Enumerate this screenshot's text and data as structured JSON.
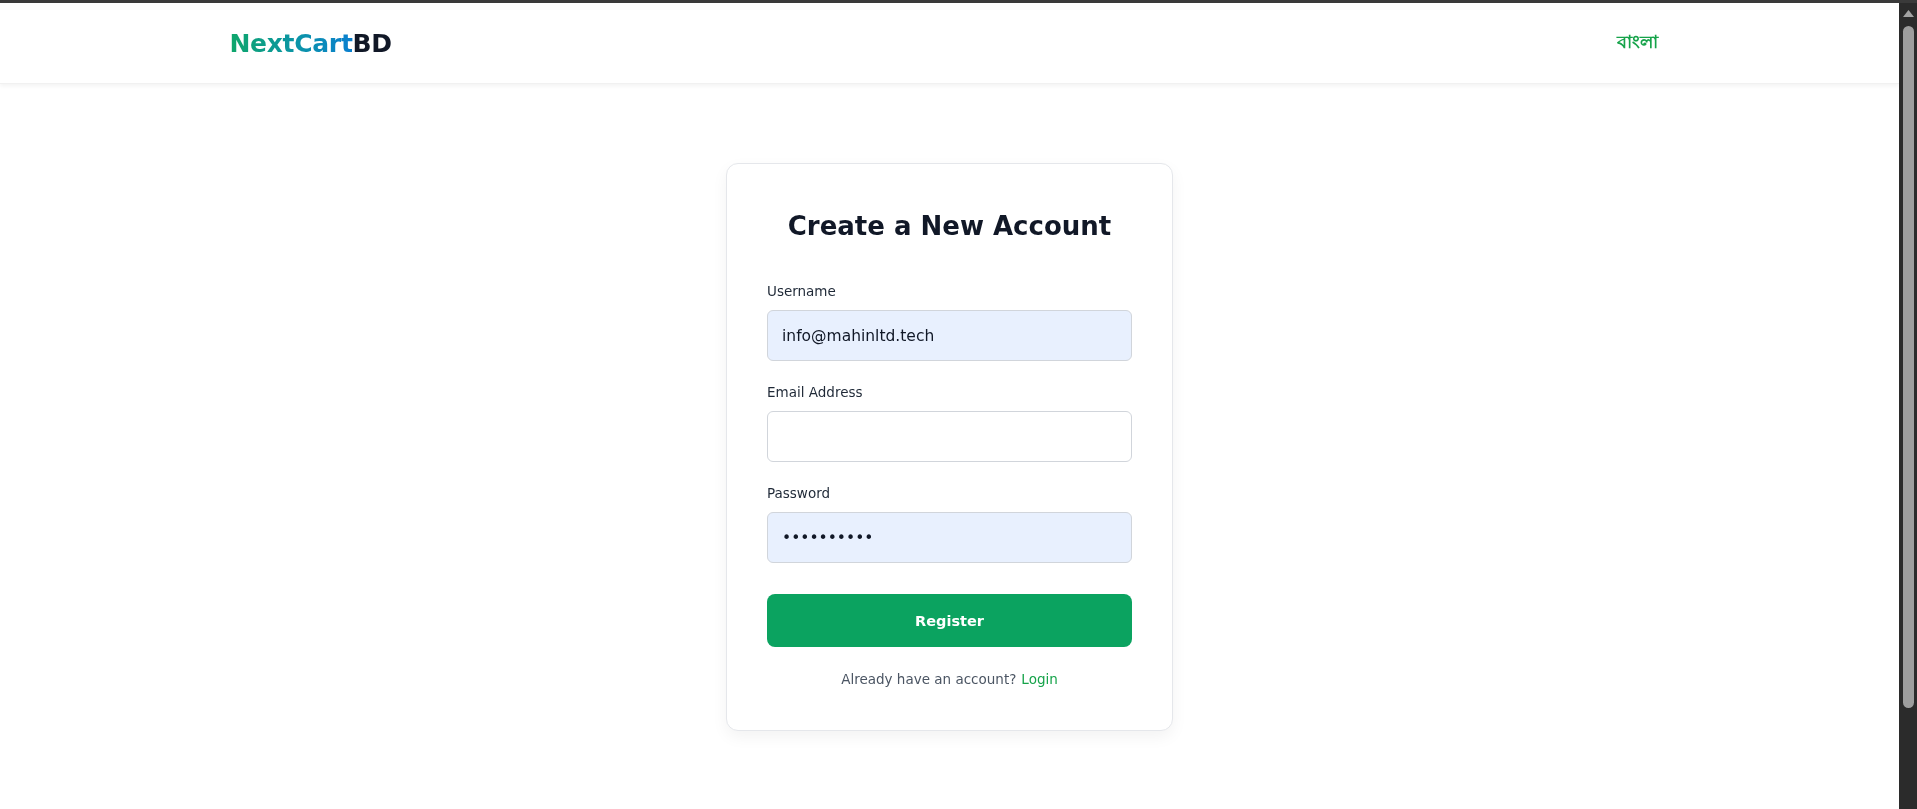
{
  "header": {
    "logo": {
      "primary": "NextCart",
      "secondary": "BD"
    },
    "language_link": "বাংলা"
  },
  "form": {
    "title": "Create a New Account",
    "fields": [
      {
        "label": "Username",
        "value": "info@mahinltd.tech",
        "autofilled": true
      },
      {
        "label": "Email Address",
        "autofilled": false
      },
      {
        "label": "Password",
        "value": "••••••••••",
        "autofilled": true
      }
    ],
    "submit": "Register",
    "footer": {
      "prompt": "Already have an account?",
      "link": "Login"
    }
  }
}
